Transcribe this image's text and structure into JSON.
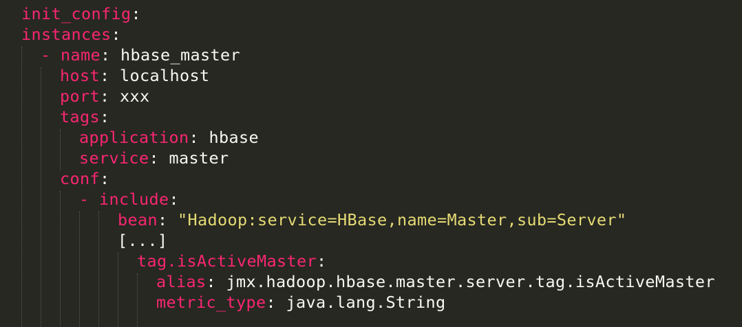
{
  "editor": {
    "theme_colors": {
      "background": "#272822",
      "key": "#f92672",
      "plain": "#f8f8f2",
      "string": "#e6db74",
      "indent_guide": "#5a5a52"
    },
    "lines": {
      "init_config": {
        "key": "init_config",
        "colon": ":"
      },
      "instances": {
        "key": "instances",
        "colon": ":"
      },
      "name": {
        "dash": "-",
        "key": "name",
        "colon": ":",
        "value": "hbase_master"
      },
      "host": {
        "key": "host",
        "colon": ":",
        "value": "localhost"
      },
      "port": {
        "key": "port",
        "colon": ":",
        "value": "xxx"
      },
      "tags": {
        "key": "tags",
        "colon": ":"
      },
      "application": {
        "key": "application",
        "colon": ":",
        "value": "hbase"
      },
      "service": {
        "key": "service",
        "colon": ":",
        "value": "master"
      },
      "conf": {
        "key": "conf",
        "colon": ":"
      },
      "include": {
        "dash": "-",
        "key": "include",
        "colon": ":"
      },
      "bean": {
        "key": "bean",
        "colon": ":",
        "value": "\"Hadoop:service=HBase,name=Master,sub=Server\""
      },
      "ellipsis": {
        "value": "[...]"
      },
      "tag_is_active_master": {
        "key": "tag.isActiveMaster",
        "colon": ":"
      },
      "alias": {
        "key": "alias",
        "colon": ":",
        "value": "jmx.hadoop.hbase.master.server.tag.isActiveMaster"
      },
      "metric_type": {
        "key": "metric_type",
        "colon": ":",
        "value": "java.lang.String"
      }
    }
  }
}
